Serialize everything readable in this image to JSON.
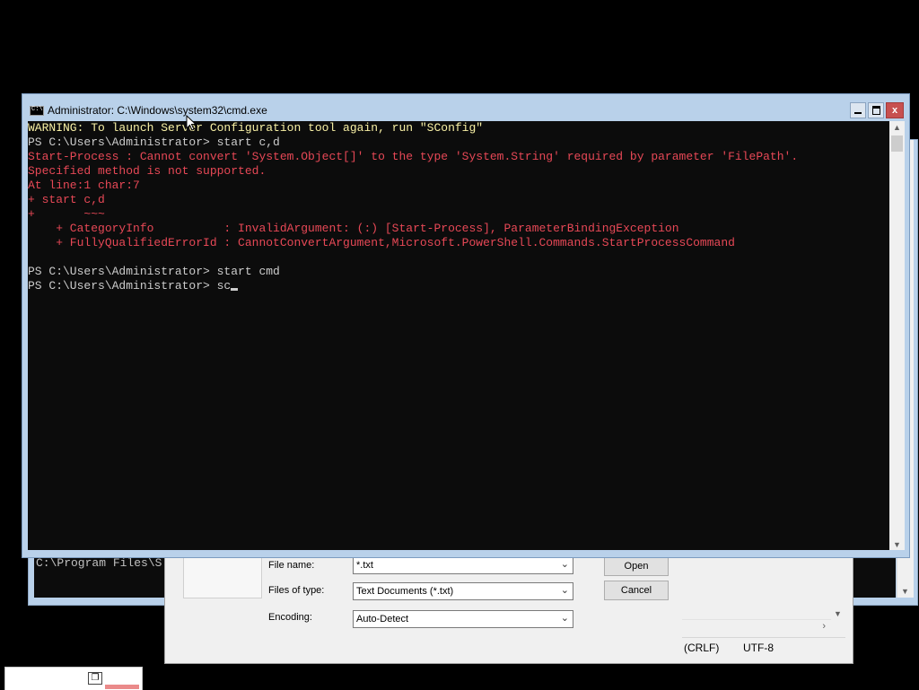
{
  "background_cmd": {
    "console_line": "C:\\Program Files\\S"
  },
  "open_dialog": {
    "file_name_label": "File name:",
    "file_name_value": "*.txt",
    "files_of_type_label": "Files of type:",
    "files_of_type_value": "Text Documents (*.txt)",
    "encoding_label": "Encoding:",
    "encoding_value": "Auto-Detect",
    "open_button": "Open",
    "cancel_button": "Cancel"
  },
  "notepad_status": {
    "line_ending": "(CRLF)",
    "encoding": "UTF-8"
  },
  "main_window": {
    "title": "Administrator: C:\\Windows\\system32\\cmd.exe",
    "icon_text": "C:\\",
    "close_glyph": "x",
    "console_lines": [
      "WARNING: To launch Server Configuration tool again, run \"SConfig\"",
      "PS C:\\Users\\Administrator> start c,d",
      "Start-Process : Cannot convert 'System.Object[]' to the type 'System.String' required by parameter 'FilePath'.",
      "Specified method is not supported.",
      "At line:1 char:7",
      "+ start c,d",
      "+       ~~~",
      "    + CategoryInfo          : InvalidArgument: (:) [Start-Process], ParameterBindingException",
      "    + FullyQualifiedErrorId : CannotConvertArgument,Microsoft.PowerShell.Commands.StartProcessCommand",
      "",
      "PS C:\\Users\\Administrator> start cmd",
      "PS C:\\Users\\Administrator> sc"
    ]
  },
  "colors": {
    "console_bg": "#0c0c0c",
    "warning": "#f9f1a5",
    "normal": "#cccccc",
    "error": "#e74856",
    "titlebar": "#b9d1ea",
    "close_button": "#c75050"
  },
  "icons": {
    "title_icon": "cmd-icon",
    "minimize": "minimize-icon",
    "maximize": "maximize-icon",
    "close": "close-icon",
    "taskbar_restore": "restore-icon"
  }
}
